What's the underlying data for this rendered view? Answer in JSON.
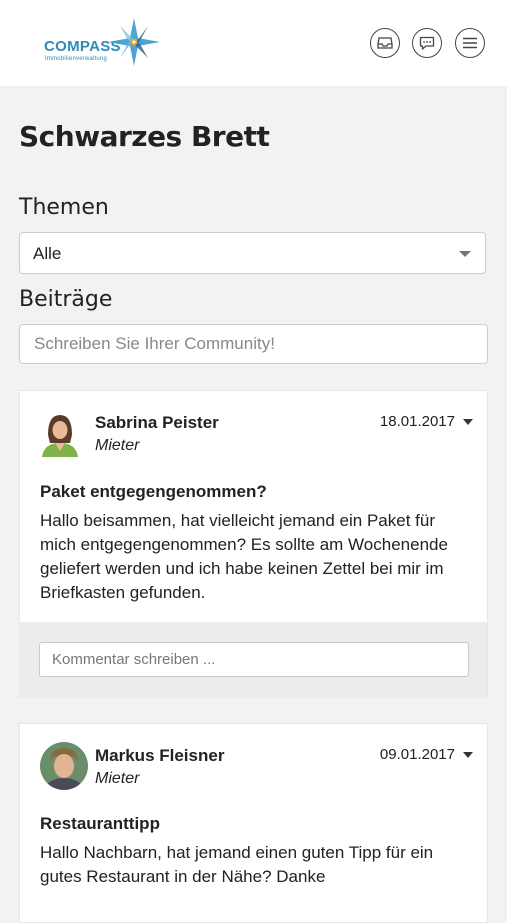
{
  "header": {
    "logo_text": "COMPASS",
    "logo_subtext": "Immobilienverwaltung",
    "icons": [
      "inbox-icon",
      "chat-icon",
      "menu-icon"
    ]
  },
  "page": {
    "title": "Schwarzes Brett"
  },
  "topics": {
    "label": "Themen",
    "selected": "Alle"
  },
  "posts_section": {
    "label": "Beiträge",
    "placeholder": "Schreiben Sie Ihrer Community!"
  },
  "posts": [
    {
      "author": "Sabrina Peister",
      "role": "Mieter",
      "date": "18.01.2017",
      "title": "Paket entgegengenommen?",
      "body": "Hallo beisammen, hat vielleicht jemand ein Paket für mich entgegengenommen? Es sollte am Wochenende geliefert werden und ich habe keinen Zettel bei mir im Briefkasten gefunden.",
      "comment_placeholder": "Kommentar schreiben ..."
    },
    {
      "author": "Markus Fleisner",
      "role": "Mieter",
      "date": "09.01.2017",
      "title": "Restauranttipp",
      "body": "Hallo Nachbarn, hat jemand einen guten Tipp für ein gutes Restaurant in der Nähe? Danke"
    }
  ],
  "colors": {
    "brand": "#2f8bb8",
    "background": "#f2f2f2",
    "comment_area": "#ececec"
  }
}
